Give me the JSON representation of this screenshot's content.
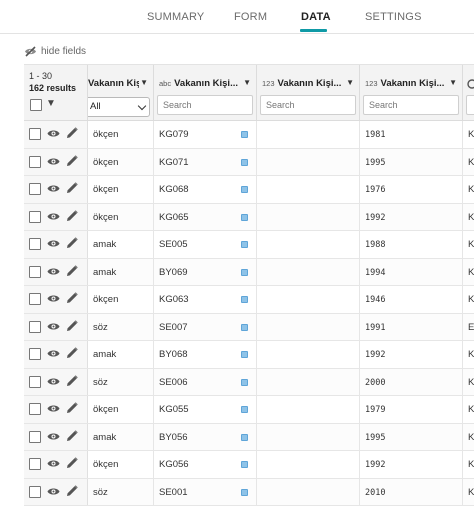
{
  "nav": {
    "tabs": [
      {
        "label": "SUMMARY"
      },
      {
        "label": "FORM"
      },
      {
        "label": "DATA"
      },
      {
        "label": "SETTINGS"
      }
    ],
    "active_tab": "DATA"
  },
  "toolbar": {
    "hide_fields_label": "hide fields",
    "hide_fields_icon": "eye-slash-icon"
  },
  "table": {
    "range_text": "1 - 30",
    "results_text": "162 results",
    "columns": [
      {
        "title": "Vakanın Kişi...",
        "type_label": "",
        "filter_value": "All"
      },
      {
        "title": "Vakanın Kişi...",
        "type_label": "abc",
        "search_placeholder": "Search"
      },
      {
        "title": "Vakanın Kişi...",
        "type_label": "123",
        "search_placeholder": "Search"
      },
      {
        "title": "Vakanın Kişi...",
        "type_label": "123",
        "search_placeholder": "Search"
      }
    ],
    "row_icons": {
      "view": "eye-icon",
      "edit": "pencil-icon",
      "link": "link-icon"
    },
    "rows": [
      {
        "c1": "ökçen",
        "c2": "KG079",
        "c3": "",
        "c4": "1981",
        "c5": "K"
      },
      {
        "c1": "ökçen",
        "c2": "KG071",
        "c3": "",
        "c4": "1995",
        "c5": "K"
      },
      {
        "c1": "ökçen",
        "c2": "KG068",
        "c3": "",
        "c4": "1976",
        "c5": "K"
      },
      {
        "c1": "ökçen",
        "c2": "KG065",
        "c3": "",
        "c4": "1992",
        "c5": "K"
      },
      {
        "c1": "amak",
        "c2": "SE005",
        "c3": "",
        "c4": "1988",
        "c5": "K"
      },
      {
        "c1": "amak",
        "c2": "BY069",
        "c3": "",
        "c4": "1994",
        "c5": "K"
      },
      {
        "c1": "ökçen",
        "c2": "KG063",
        "c3": "",
        "c4": "1946",
        "c5": "K"
      },
      {
        "c1": "söz",
        "c2": "SE007",
        "c3": "",
        "c4": "1991",
        "c5": "E"
      },
      {
        "c1": "amak",
        "c2": "BY068",
        "c3": "",
        "c4": "1992",
        "c5": "K"
      },
      {
        "c1": "söz",
        "c2": "SE006",
        "c3": "",
        "c4": "2000",
        "c5": "K"
      },
      {
        "c1": "ökçen",
        "c2": "KG055",
        "c3": "",
        "c4": "1979",
        "c5": "K"
      },
      {
        "c1": "amak",
        "c2": "BY056",
        "c3": "",
        "c4": "1995",
        "c5": "K"
      },
      {
        "c1": "ökçen",
        "c2": "KG056",
        "c3": "",
        "c4": "1992",
        "c5": "K"
      },
      {
        "c1": "söz",
        "c2": "SE001",
        "c3": "",
        "c4": "2010",
        "c5": "K"
      }
    ]
  }
}
